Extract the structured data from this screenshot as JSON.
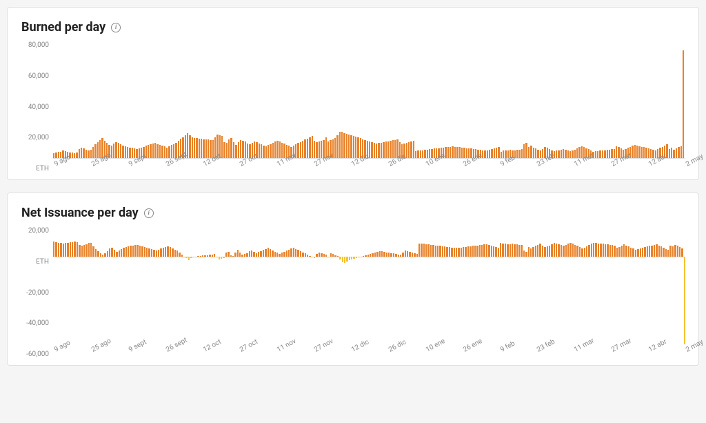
{
  "card1": {
    "title": "Burned per day"
  },
  "card2": {
    "title": "Net Issuance per day"
  },
  "yUnit": "ETH",
  "colors": {
    "positive": "#e8822a",
    "negative": "#f4c430"
  },
  "chart_data": [
    {
      "type": "bar",
      "title": "Burned per day",
      "ylabel": "ETH",
      "ylim": [
        0,
        80000
      ],
      "yticks": [
        80000,
        60000,
        40000,
        20000,
        0
      ],
      "ytick_labels": [
        "80,000",
        "60,000",
        "40,000",
        "20,000",
        "ETH"
      ],
      "categories": [
        "9 ago",
        "25 ago",
        "9 sept",
        "26 sept",
        "12 oct",
        "27 oct",
        "11 nov",
        "27 nov",
        "12 dic",
        "26 dic",
        "10 ene",
        "26 ene",
        "9 feb",
        "23 feb",
        "11 mar",
        "27 mar",
        "12 abr",
        "2 may"
      ],
      "values": [
        3500,
        4000,
        4200,
        4500,
        5000,
        4800,
        4200,
        4000,
        3800,
        3500,
        4000,
        6000,
        7000,
        6500,
        5800,
        5000,
        5500,
        7500,
        9500,
        11000,
        12500,
        13500,
        12000,
        10500,
        9000,
        8500,
        9800,
        11000,
        10200,
        9400,
        8600,
        8000,
        7500,
        7200,
        6900,
        6600,
        6300,
        6800,
        7300,
        7800,
        8300,
        8800,
        9300,
        9800,
        10300,
        9700,
        9100,
        8500,
        7900,
        7300,
        8100,
        8900,
        9700,
        10500,
        11800,
        13100,
        14400,
        15700,
        17000,
        15500,
        14000,
        13800,
        13600,
        13400,
        13200,
        13000,
        12800,
        12600,
        12400,
        12200,
        14000,
        16000,
        15500,
        15000,
        11000,
        10500,
        13000,
        13500,
        11000,
        9000,
        11000,
        12500,
        12000,
        11500,
        10000,
        9500,
        10500,
        11500,
        10800,
        10100,
        9400,
        8700,
        8000,
        8800,
        9600,
        10400,
        11200,
        12000,
        11300,
        10600,
        9900,
        9200,
        8500,
        7800,
        8600,
        9400,
        10200,
        11000,
        11800,
        12600,
        13400,
        14200,
        15000,
        12000,
        11000,
        11500,
        12000,
        12500,
        14000,
        11500,
        12200,
        12900,
        13600,
        15700,
        17800,
        18200,
        17000,
        16500,
        16000,
        15500,
        15000,
        14500,
        14000,
        13500,
        13000,
        12500,
        12000,
        11500,
        11000,
        10500,
        10000,
        10300,
        10600,
        10900,
        11200,
        11500,
        11800,
        12100,
        12400,
        12700,
        11000,
        9500,
        10000,
        10500,
        11000,
        11500,
        12000,
        4800,
        5000,
        5200,
        5400,
        5600,
        5800,
        6000,
        6200,
        6400,
        6600,
        6800,
        7000,
        7200,
        7400,
        7600,
        7800,
        8000,
        7800,
        7600,
        7400,
        7200,
        7000,
        6800,
        6600,
        6400,
        6200,
        6000,
        5800,
        5600,
        5400,
        5200,
        5000,
        5500,
        6000,
        6500,
        7000,
        7500,
        4500,
        5000,
        5200,
        5400,
        5600,
        5200,
        5400,
        5600,
        5800,
        6000,
        9500,
        10500,
        7500,
        8500,
        7300,
        6600,
        5900,
        5200,
        6300,
        7400,
        7000,
        6200,
        5400,
        4600,
        5000,
        5400,
        5800,
        6200,
        5700,
        5200,
        4700,
        5000,
        5800,
        6600,
        7400,
        8200,
        7800,
        6800,
        6000,
        5200,
        4400,
        4600,
        4800,
        5000,
        5200,
        5400,
        5600,
        5800,
        6000,
        6200,
        8000,
        7500,
        6500,
        5500,
        6200,
        6900,
        7600,
        8300,
        9000,
        8600,
        8200,
        7800,
        7400,
        7000,
        6600,
        6200,
        5800,
        5400,
        6200,
        7000,
        7800,
        8600,
        9400,
        6200,
        7000,
        5800,
        6600,
        7400,
        8200,
        74000
      ]
    },
    {
      "type": "bar",
      "title": "Net Issuance per day",
      "ylabel": "ETH",
      "ylim": [
        -60000,
        20000
      ],
      "yticks": [
        20000,
        0,
        -20000,
        -40000,
        -60000
      ],
      "ytick_labels": [
        "20,000",
        "ETH",
        "-20,000",
        "-40,000",
        "-60,000"
      ],
      "categories": [
        "9 ago",
        "25 ago",
        "9 sept",
        "26 sept",
        "12 oct",
        "27 oct",
        "11 nov",
        "27 nov",
        "12 dic",
        "26 dic",
        "10 ene",
        "26 ene",
        "9 feb",
        "23 feb",
        "11 mar",
        "27 mar",
        "12 abr",
        "2 may"
      ],
      "values": [
        10000,
        9500,
        9200,
        9000,
        8800,
        9000,
        9200,
        9500,
        9700,
        10000,
        9500,
        8000,
        7500,
        8000,
        8400,
        9000,
        9000,
        7000,
        5000,
        3500,
        2000,
        1000,
        2200,
        3700,
        5200,
        5800,
        4500,
        3300,
        4100,
        4900,
        5700,
        6300,
        6800,
        7100,
        7400,
        7700,
        8000,
        7500,
        7000,
        6500,
        6000,
        5500,
        5000,
        4500,
        4000,
        4600,
        5200,
        5800,
        6400,
        7000,
        6200,
        5400,
        4600,
        3800,
        2500,
        1200,
        -100,
        -1400,
        -2700,
        -1200,
        -300,
        -100,
        100,
        300,
        500,
        700,
        900,
        1100,
        1300,
        1500,
        -300,
        -2300,
        -1800,
        -1300,
        2700,
        3200,
        700,
        200,
        2700,
        4700,
        2700,
        1200,
        1700,
        2200,
        3700,
        4200,
        3200,
        2200,
        2900,
        3600,
        4300,
        5000,
        5700,
        4900,
        4100,
        3300,
        2500,
        1700,
        2400,
        3100,
        3800,
        4500,
        5200,
        5900,
        5100,
        4300,
        3500,
        2700,
        1900,
        1100,
        300,
        -500,
        -1300,
        1700,
        2700,
        2200,
        1700,
        1200,
        -300,
        2200,
        1500,
        800,
        100,
        -2000,
        -4100,
        -4500,
        -3300,
        -2800,
        -2300,
        -1800,
        -1300,
        -800,
        -300,
        200,
        700,
        1200,
        1700,
        2200,
        2700,
        3200,
        3700,
        3400,
        3100,
        2800,
        2500,
        2200,
        1900,
        1600,
        1300,
        1000,
        2700,
        4200,
        3700,
        3200,
        2700,
        2200,
        1700,
        8900,
        8700,
        8500,
        8300,
        8100,
        7900,
        7700,
        7500,
        7300,
        7100,
        6900,
        6700,
        6500,
        6300,
        6100,
        5900,
        5700,
        5900,
        6100,
        6300,
        6500,
        6700,
        6900,
        7100,
        7300,
        7500,
        7700,
        7900,
        8100,
        8300,
        7800,
        7300,
        6800,
        6300,
        5800,
        9200,
        8700,
        8500,
        8300,
        8100,
        8500,
        8300,
        8100,
        7900,
        7700,
        4200,
        3200,
        6200,
        5200,
        6400,
        7100,
        7800,
        8500,
        7400,
        6300,
        6700,
        7500,
        8300,
        9100,
        8700,
        8300,
        7900,
        7500,
        8000,
        8500,
        9000,
        8700,
        7900,
        7100,
        6300,
        5500,
        5900,
        6900,
        7700,
        8500,
        9300,
        9100,
        8900,
        8700,
        8500,
        8300,
        8100,
        7900,
        7700,
        7500,
        5700,
        6200,
        7200,
        8200,
        7500,
        6800,
        6100,
        5400,
        4700,
        5100,
        5500,
        5900,
        6300,
        6700,
        7100,
        7500,
        7900,
        8300,
        7500,
        6700,
        5900,
        5100,
        4300,
        7500,
        6700,
        7900,
        7100,
        6300,
        5500,
        -60000
      ]
    }
  ]
}
